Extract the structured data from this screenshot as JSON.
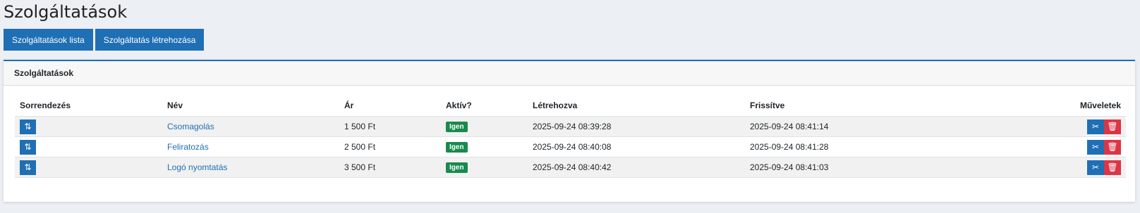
{
  "page": {
    "title": "Szolgáltatások"
  },
  "toolbar": {
    "list_label": "Szolgáltatások lista",
    "create_label": "Szolgáltatás létrehozása"
  },
  "card": {
    "title": "Szolgáltatások"
  },
  "table": {
    "headers": {
      "sort": "Sorrendezés",
      "name": "Név",
      "price": "Ár",
      "active": "Aktív?",
      "created": "Létrehozva",
      "updated": "Frissítve",
      "ops": "Műveletek"
    },
    "rows": [
      {
        "name": "Csomagolás",
        "price": "1 500 Ft",
        "active": "Igen",
        "created": "2025-09-24 08:39:28",
        "updated": "2025-09-24 08:41:14"
      },
      {
        "name": "Feliratozás",
        "price": "2 500 Ft",
        "active": "Igen",
        "created": "2025-09-24 08:40:08",
        "updated": "2025-09-24 08:41:28"
      },
      {
        "name": "Logó nyomtatás",
        "price": "3 500 Ft",
        "active": "Igen",
        "created": "2025-09-24 08:40:42",
        "updated": "2025-09-24 08:41:03"
      }
    ]
  },
  "icons": {
    "sort": "sort-arrows-icon",
    "edit": "scissors-icon",
    "delete": "trash-icon"
  },
  "colors": {
    "primary": "#1f6fb5",
    "success": "#188a4d",
    "danger": "#dc3545"
  }
}
